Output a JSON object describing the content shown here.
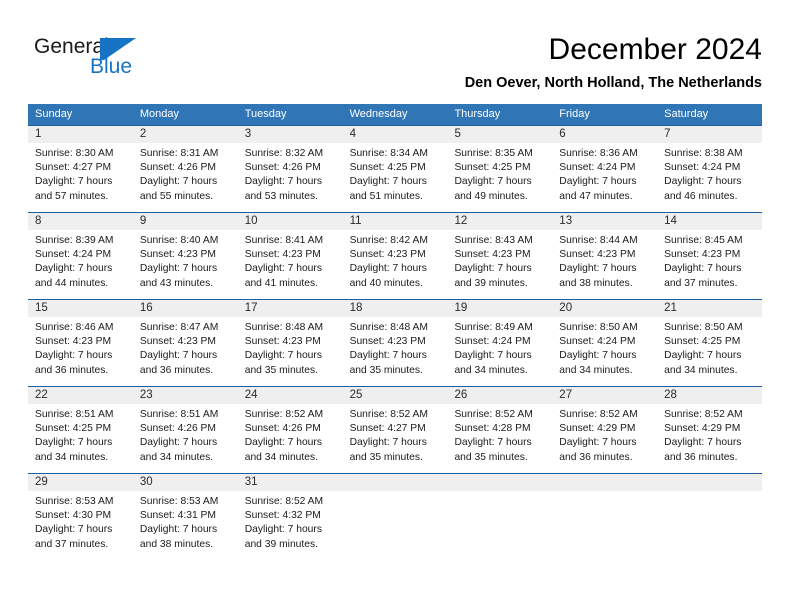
{
  "brand": {
    "name_part1": "General",
    "name_part2": "Blue",
    "flag_icon": "flag-triangle-icon",
    "accent_color": "#1773c4"
  },
  "header": {
    "title": "December 2024",
    "subtitle": "Den Oever, North Holland, The Netherlands"
  },
  "theme": {
    "header_bg": "#3075b5",
    "week_divider": "#1c5f9e",
    "daynum_bg": "#efefef",
    "text": "#1b1b1b"
  },
  "weekdays": [
    "Sunday",
    "Monday",
    "Tuesday",
    "Wednesday",
    "Thursday",
    "Friday",
    "Saturday"
  ],
  "weeks": [
    [
      {
        "day": "1",
        "lines": [
          "Sunrise: 8:30 AM",
          "Sunset: 4:27 PM",
          "Daylight: 7 hours",
          "and 57 minutes."
        ]
      },
      {
        "day": "2",
        "lines": [
          "Sunrise: 8:31 AM",
          "Sunset: 4:26 PM",
          "Daylight: 7 hours",
          "and 55 minutes."
        ]
      },
      {
        "day": "3",
        "lines": [
          "Sunrise: 8:32 AM",
          "Sunset: 4:26 PM",
          "Daylight: 7 hours",
          "and 53 minutes."
        ]
      },
      {
        "day": "4",
        "lines": [
          "Sunrise: 8:34 AM",
          "Sunset: 4:25 PM",
          "Daylight: 7 hours",
          "and 51 minutes."
        ]
      },
      {
        "day": "5",
        "lines": [
          "Sunrise: 8:35 AM",
          "Sunset: 4:25 PM",
          "Daylight: 7 hours",
          "and 49 minutes."
        ]
      },
      {
        "day": "6",
        "lines": [
          "Sunrise: 8:36 AM",
          "Sunset: 4:24 PM",
          "Daylight: 7 hours",
          "and 47 minutes."
        ]
      },
      {
        "day": "7",
        "lines": [
          "Sunrise: 8:38 AM",
          "Sunset: 4:24 PM",
          "Daylight: 7 hours",
          "and 46 minutes."
        ]
      }
    ],
    [
      {
        "day": "8",
        "lines": [
          "Sunrise: 8:39 AM",
          "Sunset: 4:24 PM",
          "Daylight: 7 hours",
          "and 44 minutes."
        ]
      },
      {
        "day": "9",
        "lines": [
          "Sunrise: 8:40 AM",
          "Sunset: 4:23 PM",
          "Daylight: 7 hours",
          "and 43 minutes."
        ]
      },
      {
        "day": "10",
        "lines": [
          "Sunrise: 8:41 AM",
          "Sunset: 4:23 PM",
          "Daylight: 7 hours",
          "and 41 minutes."
        ]
      },
      {
        "day": "11",
        "lines": [
          "Sunrise: 8:42 AM",
          "Sunset: 4:23 PM",
          "Daylight: 7 hours",
          "and 40 minutes."
        ]
      },
      {
        "day": "12",
        "lines": [
          "Sunrise: 8:43 AM",
          "Sunset: 4:23 PM",
          "Daylight: 7 hours",
          "and 39 minutes."
        ]
      },
      {
        "day": "13",
        "lines": [
          "Sunrise: 8:44 AM",
          "Sunset: 4:23 PM",
          "Daylight: 7 hours",
          "and 38 minutes."
        ]
      },
      {
        "day": "14",
        "lines": [
          "Sunrise: 8:45 AM",
          "Sunset: 4:23 PM",
          "Daylight: 7 hours",
          "and 37 minutes."
        ]
      }
    ],
    [
      {
        "day": "15",
        "lines": [
          "Sunrise: 8:46 AM",
          "Sunset: 4:23 PM",
          "Daylight: 7 hours",
          "and 36 minutes."
        ]
      },
      {
        "day": "16",
        "lines": [
          "Sunrise: 8:47 AM",
          "Sunset: 4:23 PM",
          "Daylight: 7 hours",
          "and 36 minutes."
        ]
      },
      {
        "day": "17",
        "lines": [
          "Sunrise: 8:48 AM",
          "Sunset: 4:23 PM",
          "Daylight: 7 hours",
          "and 35 minutes."
        ]
      },
      {
        "day": "18",
        "lines": [
          "Sunrise: 8:48 AM",
          "Sunset: 4:23 PM",
          "Daylight: 7 hours",
          "and 35 minutes."
        ]
      },
      {
        "day": "19",
        "lines": [
          "Sunrise: 8:49 AM",
          "Sunset: 4:24 PM",
          "Daylight: 7 hours",
          "and 34 minutes."
        ]
      },
      {
        "day": "20",
        "lines": [
          "Sunrise: 8:50 AM",
          "Sunset: 4:24 PM",
          "Daylight: 7 hours",
          "and 34 minutes."
        ]
      },
      {
        "day": "21",
        "lines": [
          "Sunrise: 8:50 AM",
          "Sunset: 4:25 PM",
          "Daylight: 7 hours",
          "and 34 minutes."
        ]
      }
    ],
    [
      {
        "day": "22",
        "lines": [
          "Sunrise: 8:51 AM",
          "Sunset: 4:25 PM",
          "Daylight: 7 hours",
          "and 34 minutes."
        ]
      },
      {
        "day": "23",
        "lines": [
          "Sunrise: 8:51 AM",
          "Sunset: 4:26 PM",
          "Daylight: 7 hours",
          "and 34 minutes."
        ]
      },
      {
        "day": "24",
        "lines": [
          "Sunrise: 8:52 AM",
          "Sunset: 4:26 PM",
          "Daylight: 7 hours",
          "and 34 minutes."
        ]
      },
      {
        "day": "25",
        "lines": [
          "Sunrise: 8:52 AM",
          "Sunset: 4:27 PM",
          "Daylight: 7 hours",
          "and 35 minutes."
        ]
      },
      {
        "day": "26",
        "lines": [
          "Sunrise: 8:52 AM",
          "Sunset: 4:28 PM",
          "Daylight: 7 hours",
          "and 35 minutes."
        ]
      },
      {
        "day": "27",
        "lines": [
          "Sunrise: 8:52 AM",
          "Sunset: 4:29 PM",
          "Daylight: 7 hours",
          "and 36 minutes."
        ]
      },
      {
        "day": "28",
        "lines": [
          "Sunrise: 8:52 AM",
          "Sunset: 4:29 PM",
          "Daylight: 7 hours",
          "and 36 minutes."
        ]
      }
    ],
    [
      {
        "day": "29",
        "lines": [
          "Sunrise: 8:53 AM",
          "Sunset: 4:30 PM",
          "Daylight: 7 hours",
          "and 37 minutes."
        ]
      },
      {
        "day": "30",
        "lines": [
          "Sunrise: 8:53 AM",
          "Sunset: 4:31 PM",
          "Daylight: 7 hours",
          "and 38 minutes."
        ]
      },
      {
        "day": "31",
        "lines": [
          "Sunrise: 8:52 AM",
          "Sunset: 4:32 PM",
          "Daylight: 7 hours",
          "and 39 minutes."
        ]
      },
      {
        "day": "",
        "lines": []
      },
      {
        "day": "",
        "lines": []
      },
      {
        "day": "",
        "lines": []
      },
      {
        "day": "",
        "lines": []
      }
    ]
  ]
}
